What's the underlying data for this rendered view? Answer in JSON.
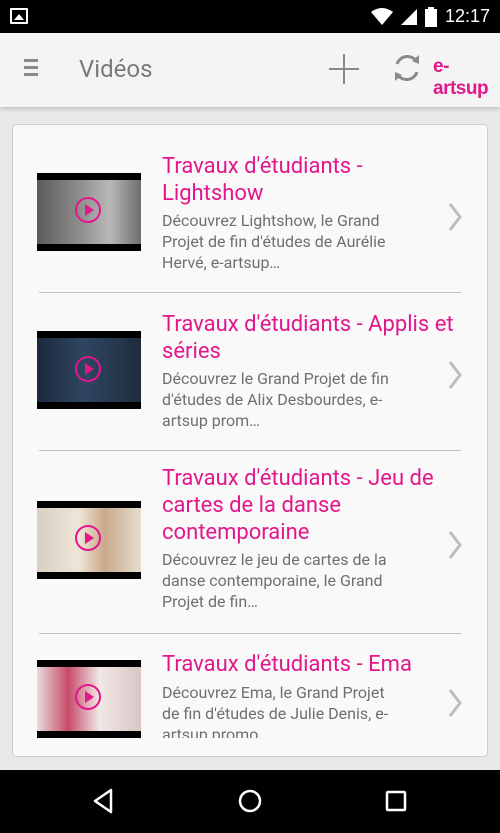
{
  "status_bar": {
    "time": "12:17"
  },
  "app_bar": {
    "title": "Vidéos",
    "logo": "e-artsup"
  },
  "videos": [
    {
      "title": "Travaux d'étudiants - Lightshow",
      "description": "Découvrez Lightshow, le Grand Projet de fin d'études de Aurélie Hervé, e-artsup…"
    },
    {
      "title": "Travaux d'étudiants - Applis et séries",
      "description": "Découvrez le Grand Projet de fin d'études de Alix Desbourdes, e-artsup prom…"
    },
    {
      "title": "Travaux d'étudiants - Jeu de cartes de la danse contemporaine",
      "description": "Découvrez le jeu de cartes de la danse contemporaine, le Grand Projet de fin…"
    },
    {
      "title": "Travaux d'étudiants - Ema",
      "description": "Découvrez Ema, le Grand Projet de fin d'études de Julie Denis, e-artsup promo…"
    }
  ],
  "colors": {
    "accent": "#e2178c",
    "text_secondary": "#6f6f6f"
  }
}
